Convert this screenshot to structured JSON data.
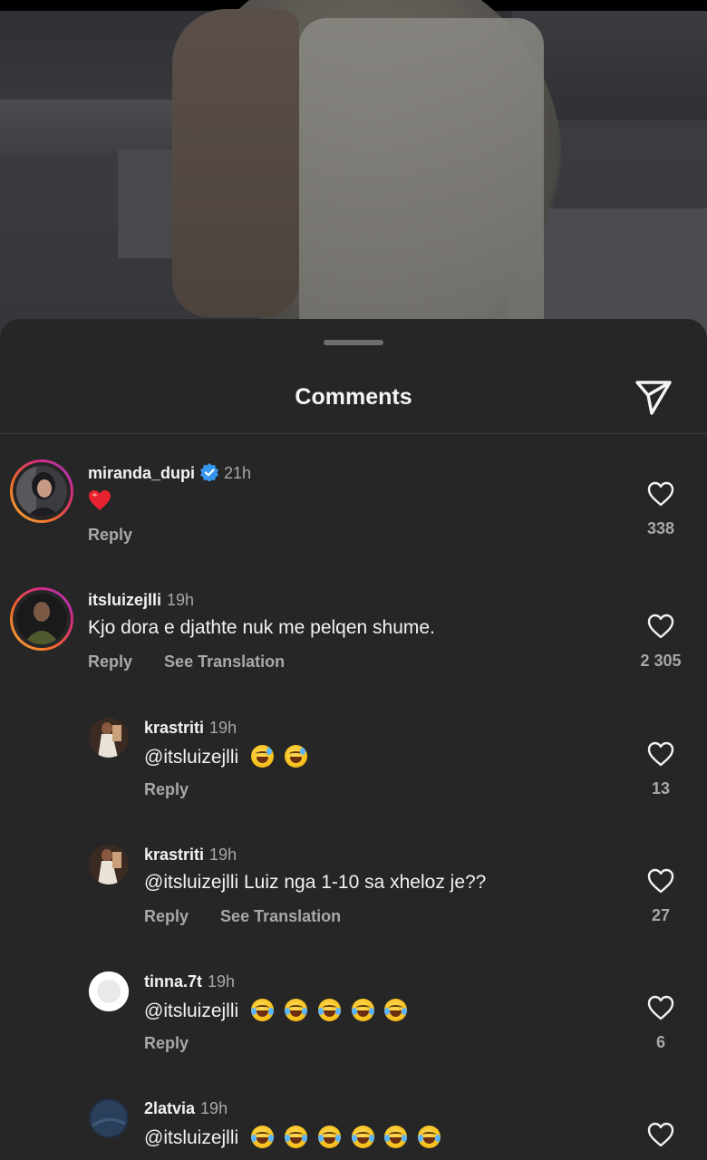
{
  "sheet": {
    "title": "Comments",
    "share_icon": "paper-plane-icon"
  },
  "colors": {
    "sheet_bg": "#262626",
    "primary_text": "#f2f2f2",
    "secondary_text": "#a8a8a8",
    "verified_blue": "#3797f0",
    "story_ring": [
      "#f7b23b",
      "#d62b7a",
      "#a03bd1"
    ]
  },
  "comments": [
    {
      "username": "miranda_dupi",
      "verified": true,
      "time": "21h",
      "text": "❤️",
      "actions": [
        "Reply"
      ],
      "likes": "338"
    },
    {
      "username": "itsluizejlli",
      "verified": false,
      "time": "19h",
      "text": "Kjo dora e djathte nuk me pelqen shume.",
      "actions": [
        "Reply",
        "See Translation"
      ],
      "likes": "2 305"
    },
    {
      "username": "krastriti",
      "time": "19h",
      "text": "@itsluizejlli",
      "emoji": "😅😅",
      "actions": [
        "Reply"
      ],
      "likes": "13",
      "is_reply": true
    },
    {
      "username": "krastriti",
      "time": "19h",
      "text": "@itsluizejlli Luiz nga 1-10 sa xheloz je??",
      "actions": [
        "Reply",
        "See Translation"
      ],
      "likes": "27",
      "is_reply": true
    },
    {
      "username": "tinna.7t",
      "time": "19h",
      "text": "@itsluizejlli",
      "emoji": "😂😂😂😂😂",
      "actions": [
        "Reply"
      ],
      "likes": "6",
      "is_reply": true
    },
    {
      "username": "2latvia",
      "time": "19h",
      "text": "@itsluizejlli",
      "emoji": "😂😂😂😂😂😂",
      "actions": [],
      "likes": "",
      "is_reply": true
    }
  ]
}
